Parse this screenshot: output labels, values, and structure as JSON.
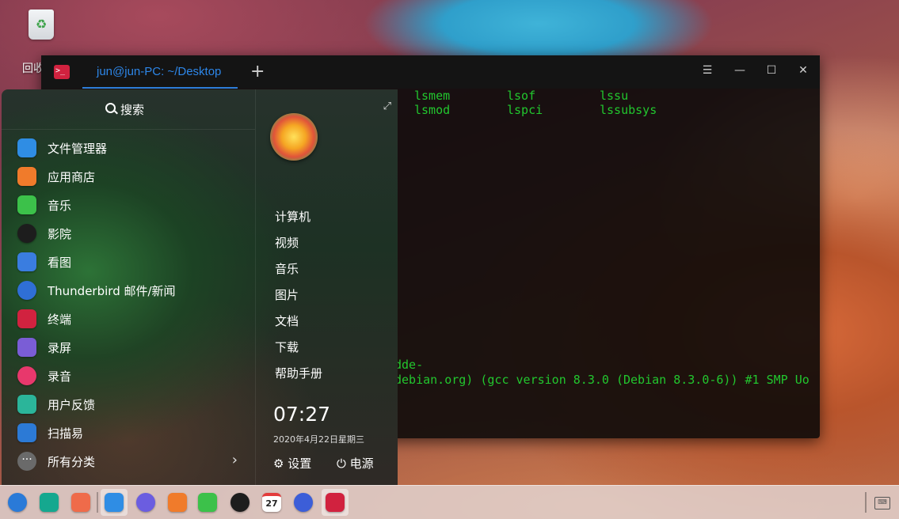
{
  "desktop": {
    "trash_label": "回收站"
  },
  "terminal": {
    "tab_title": "jun@jun-PC: ~/Desktop",
    "new_tab": "+",
    "menu_glyph": "☰",
    "minimize_glyph": "—",
    "maximize_glyph": "☐",
    "close_glyph": "✕",
    "columns": [
      [
        "lsmem",
        "lsmod"
      ],
      [
        "lsof",
        "lspci"
      ],
      [
        "lssu",
        "lssubsys"
      ]
    ],
    "output_lines": [
      "dde-",
      " debian.org) (gcc version 8.3.0 (Debian 8.3.0-6)) #1 SMP Uo"
    ],
    "text_color": "#22c62e"
  },
  "launcher": {
    "search_label": "搜索",
    "apps": [
      {
        "label": "文件管理器",
        "icon": "file-manager-icon",
        "color": "#2f8de4"
      },
      {
        "label": "应用商店",
        "icon": "app-store-icon",
        "color": "#f07b2b"
      },
      {
        "label": "音乐",
        "icon": "music-icon",
        "color": "#3cc14a"
      },
      {
        "label": "影院",
        "icon": "movie-icon",
        "color": "#1d1d1d"
      },
      {
        "label": "看图",
        "icon": "image-viewer-icon",
        "color": "#3a7de0"
      },
      {
        "label": "Thunderbird 邮件/新闻",
        "icon": "thunderbird-icon",
        "color": "#2f6fd6"
      },
      {
        "label": "终端",
        "icon": "terminal-icon",
        "color": "#d1223f"
      },
      {
        "label": "录屏",
        "icon": "screen-recorder-icon",
        "color": "#7a5dd6"
      },
      {
        "label": "录音",
        "icon": "voice-recorder-icon",
        "color": "#e8386c"
      },
      {
        "label": "用户反馈",
        "icon": "feedback-icon",
        "color": "#2bb59a"
      },
      {
        "label": "扫描易",
        "icon": "scanner-icon",
        "color": "#2c7ad6"
      }
    ],
    "all_categories": "所有分类",
    "places": [
      "计算机",
      "视频",
      "音乐",
      "图片",
      "文档",
      "下载",
      "帮助手册"
    ],
    "clock_time": "07:27",
    "clock_date": "2020年4月22日星期三",
    "settings_label": "设置",
    "power_label": "电源"
  },
  "dock": {
    "items": [
      {
        "name": "launcher-icon",
        "color": "#2a7ad8",
        "active": false,
        "text": ""
      },
      {
        "name": "multitasking-icon",
        "color": "#15a88f",
        "active": false,
        "text": ""
      },
      {
        "name": "show-desktop-icon",
        "color": "#ef6b4a",
        "active": false,
        "text": ""
      },
      {
        "name": "file-manager-icon",
        "color": "#2f8de4",
        "active": true,
        "text": ""
      },
      {
        "name": "browser-icon",
        "color": "#6b5de0",
        "active": false,
        "text": ""
      },
      {
        "name": "app-store-icon",
        "color": "#f07b2b",
        "active": false,
        "text": ""
      },
      {
        "name": "music-icon",
        "color": "#3cc14a",
        "active": false,
        "text": ""
      },
      {
        "name": "movie-icon",
        "color": "#1d1d1d",
        "active": false,
        "text": ""
      },
      {
        "name": "calendar-icon",
        "color": "#e33b3b",
        "active": false,
        "text": "27"
      },
      {
        "name": "control-center-icon",
        "color": "#3c5ed8",
        "active": false,
        "text": ""
      },
      {
        "name": "terminal-icon",
        "color": "#d1223f",
        "active": true,
        "text": ""
      }
    ]
  }
}
